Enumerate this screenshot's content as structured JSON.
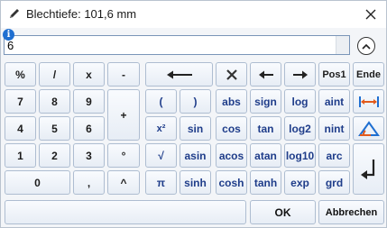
{
  "window": {
    "title": "Blechtiefe: 101,6 mm",
    "title_icon": "pencil-icon",
    "close_icon": "close-icon"
  },
  "input": {
    "value": "6",
    "info_badge": "i"
  },
  "keys": {
    "percent": "%",
    "divide": "/",
    "multiply": "x",
    "minus": "-",
    "plus": "+",
    "seven": "7",
    "eight": "8",
    "nine": "9",
    "four": "4",
    "five": "5",
    "six": "6",
    "one": "1",
    "two": "2",
    "three": "3",
    "zero": "0",
    "comma": ",",
    "degree": "°",
    "power": "^",
    "paren_open": "(",
    "paren_close": ")",
    "abs": "abs",
    "sign": "sign",
    "log": "log",
    "aint": "aint",
    "square": "x²",
    "sin": "sin",
    "cos": "cos",
    "tan": "tan",
    "log2": "log2",
    "nint": "nint",
    "sqrt": "√",
    "asin": "asin",
    "acos": "acos",
    "atan": "atan",
    "log10": "log10",
    "arc": "arc",
    "pi": "π",
    "sinh": "sinh",
    "cosh": "cosh",
    "tanh": "tanh",
    "exp": "exp",
    "grd": "grd",
    "pos1": "Pos1",
    "ende": "Ende",
    "ok": "OK",
    "cancel": "Abbrechen"
  },
  "colors": {
    "function_text": "#1f3d8a",
    "accent_blue": "#1f6fd1"
  }
}
